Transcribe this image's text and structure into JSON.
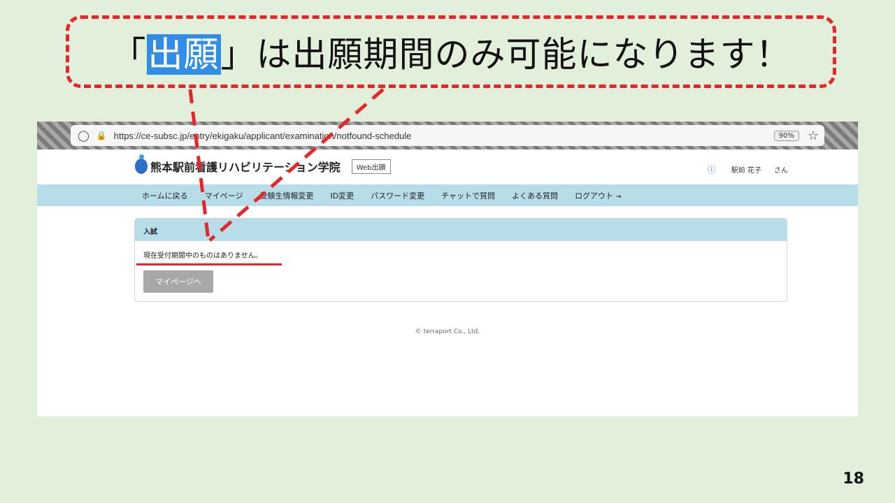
{
  "callout": {
    "open_bracket": "「",
    "highlight": "出願",
    "rest": "」は出願期間のみ可能になります！"
  },
  "browser": {
    "url": "https://ce-subsc.jp/entry/ekigaku/applicant/examination/notfound-schedule",
    "zoom": "90%",
    "shield_icon": "◯",
    "lock_icon": "🔒",
    "star_icon": "☆"
  },
  "site": {
    "name": "熊本駅前看護リハビリテーション学院",
    "badge": "Web出願",
    "user_name": "駅前 花子",
    "user_suffix": "さん"
  },
  "nav": {
    "items": [
      {
        "label": "ホームに戻る"
      },
      {
        "label": "マイページ"
      },
      {
        "label": "受験生情報変更"
      },
      {
        "label": "ID変更"
      },
      {
        "label": "パスワード変更"
      },
      {
        "label": "チャットで質問"
      },
      {
        "label": "よくある質問"
      },
      {
        "label": "ログアウト"
      }
    ]
  },
  "panel": {
    "title": "入試",
    "message": "現在受付期間中のものはありません。",
    "button_label": "マイページへ"
  },
  "footer": {
    "copyright": "© terraport Co., Ltd."
  },
  "slide": {
    "page_number": "18"
  },
  "colors": {
    "background": "#e2efda",
    "accent_red": "#e8262a",
    "highlight_blue": "#2f8fe8",
    "nav_bar": "#b7dde8"
  }
}
